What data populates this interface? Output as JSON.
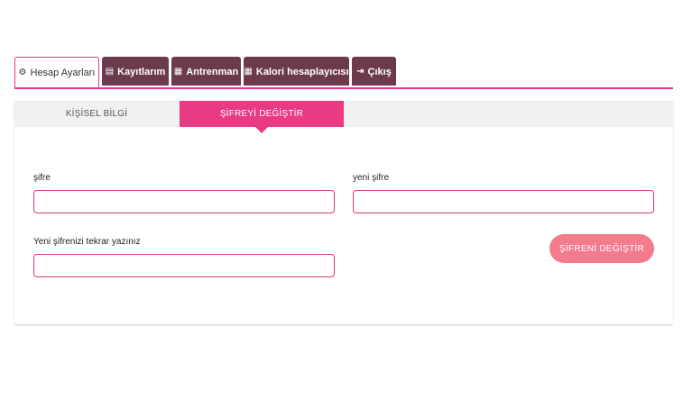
{
  "nav": {
    "tabs": [
      {
        "label": "Hesap Ayarları",
        "icon": "gear-icon",
        "glyph": "⚙"
      },
      {
        "label": "Kayıtlarım",
        "icon": "id-card-icon",
        "glyph": "▤"
      },
      {
        "label": "Antrenman",
        "icon": "calendar-icon",
        "glyph": "▦"
      },
      {
        "label": "Kalori hesaplayıcısı",
        "icon": "calendar-icon",
        "glyph": "▦"
      },
      {
        "label": "Çıkış",
        "icon": "sign-out-icon",
        "glyph": "⇥"
      }
    ],
    "active_index": 0
  },
  "subtabs": {
    "personal": "KİŞİSEL BİLGİ",
    "password": "ŞİFREYİ DEĞİŞTİR"
  },
  "form": {
    "current_password_label": "şifre",
    "new_password_label": "yeni şifre",
    "repeat_password_label": "Yeni şifrenizi tekrar yazınız",
    "current_password_value": "",
    "new_password_value": "",
    "repeat_password_value": "",
    "submit_label": "ŞİFRENİ DEĞİŞTİR"
  },
  "colors": {
    "accent": "#e8318a",
    "tab_bg": "#6b3b4d",
    "button": "#f47b8c"
  }
}
